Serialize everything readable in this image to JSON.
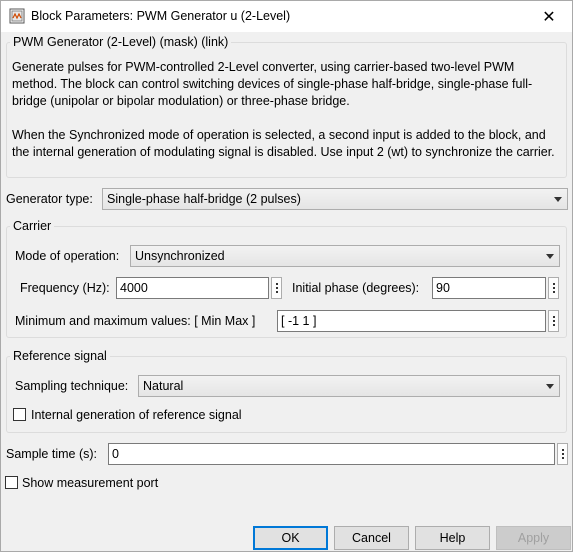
{
  "window": {
    "title": "Block Parameters: PWM Generator u (2-Level)",
    "close_glyph": "✕"
  },
  "mask": {
    "header": "PWM Generator (2-Level) (mask) (link)",
    "desc1": "Generate pulses for PWM-controlled 2-Level converter, using carrier-based two-level PWM method. The block can control switching devices of single-phase half-bridge, single-phase full-bridge (unipolar or bipolar modulation) or three-phase bridge.",
    "desc2": "When the Synchronized mode of operation is selected, a second input is added to the block, and the internal generation of modulating signal is disabled. Use input 2 (wt) to synchronize the carrier."
  },
  "generator": {
    "label": "Generator type:",
    "value": "Single-phase half-bridge (2 pulses)"
  },
  "carrier": {
    "legend": "Carrier",
    "mode_label": "Mode of operation:",
    "mode_value": "Unsynchronized",
    "freq_label": "Frequency (Hz):",
    "freq_value": "4000",
    "phase_label": "Initial phase (degrees):",
    "phase_value": "90",
    "minmax_label": "Minimum and maximum values: [ Min  Max ]",
    "minmax_value": "[ -1  1 ]"
  },
  "reference": {
    "legend": "Reference signal",
    "sampling_label": "Sampling technique:",
    "sampling_value": "Natural",
    "internal_label": "Internal generation of reference signal",
    "internal_checked": false
  },
  "sample": {
    "label": "Sample time (s):",
    "value": "0"
  },
  "measurement": {
    "label": "Show measurement port",
    "checked": false
  },
  "buttons": {
    "ok": "OK",
    "cancel": "Cancel",
    "help": "Help",
    "apply": "Apply"
  },
  "icons": {
    "app": "simulink-block-icon",
    "close": "close-icon",
    "dropdown": "chevron-down-icon",
    "more": "vertical-ellipsis-icon"
  }
}
